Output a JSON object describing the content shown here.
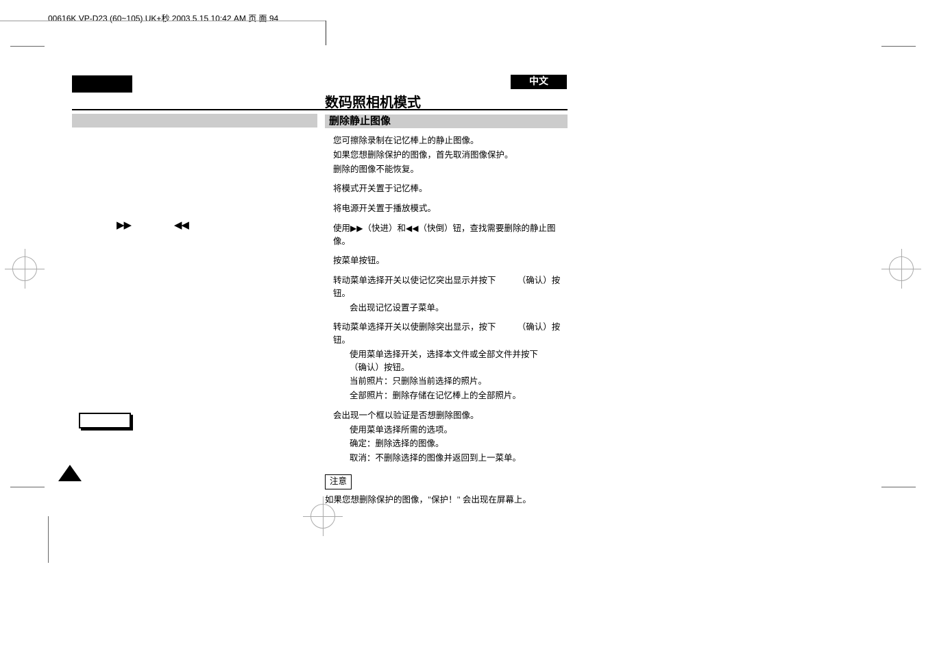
{
  "header": "00616K VP-D23 (60~105) UK+秒 2003.5.15 10:42 AM 页 面 94",
  "lang_badge": "中文",
  "title": "数码照相机模式",
  "section": "删除静止图像",
  "intro": [
    "您可擦除录制在记忆棒上的静止图像。",
    "如果您想删除保护的图像，首先取消图像保护。",
    "删除的图像不能恢复。"
  ],
  "steps": {
    "s1": "将模式开关置于记忆棒。",
    "s2": "将电源开关置于播放模式。",
    "s3_pre": "使用",
    "s3_mid": "（快进）和",
    "s3_post": "（快倒）钮，查找需要删除的静止图像。",
    "s4": "按菜单按钮。",
    "s5_main": "转动菜单选择开关以使记忆突出显示并按下　　　（确认）按钮。",
    "s5_sub": "会出现记忆设置子菜单。",
    "s6_main": "转动菜单选择开关以使删除突出显示，按下　　　（确认）按钮。",
    "s6_sub1": "使用菜单选择开关，选择本文件或全部文件并按下　　　（确认）按钮。",
    "s6_sub2": "当前照片：只删除当前选择的照片。",
    "s6_sub3": "全部照片：删除存储在记忆棒上的全部照片。",
    "s7_main": "会出现一个框以验证是否想删除图像。",
    "s7_sub1": "使用菜单选择所需的选项。",
    "s7_sub2": "确定：删除选择的图像。",
    "s7_sub3": "取消：不删除选择的图像并返回到上一菜单。"
  },
  "notice_label": "注意",
  "notice_text": "如果您想删除保护的图像，\"保护！\" 会出现在屏幕上。"
}
